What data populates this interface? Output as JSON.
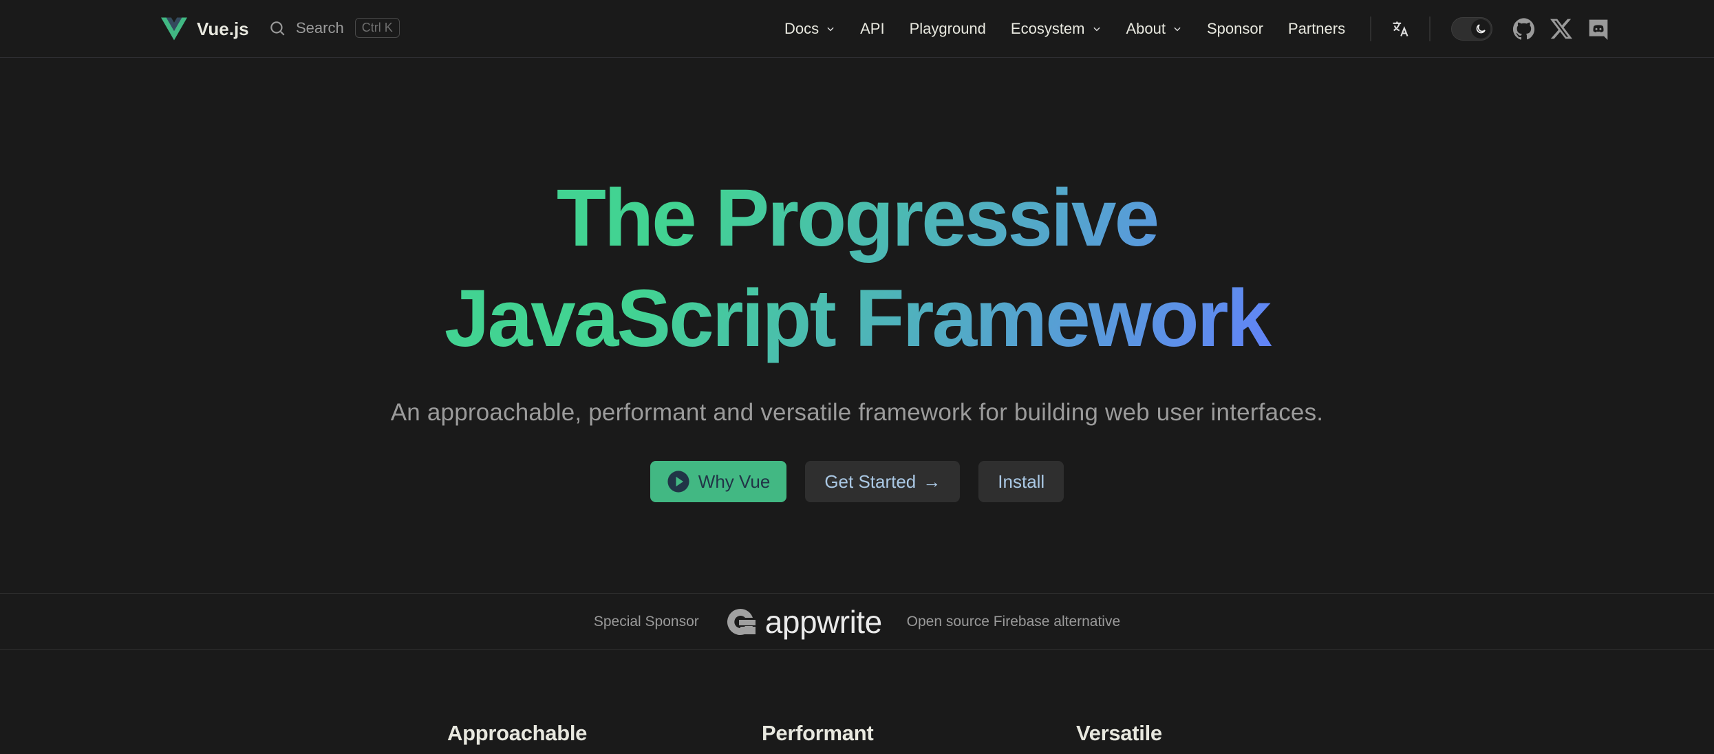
{
  "nav": {
    "logo_text": "Vue.js",
    "search_label": "Search",
    "search_shortcut": "Ctrl K",
    "links": [
      {
        "label": "Docs",
        "dropdown": true
      },
      {
        "label": "API",
        "dropdown": false
      },
      {
        "label": "Playground",
        "dropdown": false
      },
      {
        "label": "Ecosystem",
        "dropdown": true
      },
      {
        "label": "About",
        "dropdown": true
      },
      {
        "label": "Sponsor",
        "dropdown": false
      },
      {
        "label": "Partners",
        "dropdown": false
      }
    ],
    "icons": [
      "translate-icon",
      "dark-mode-toggle",
      "github-icon",
      "x-twitter-icon",
      "discord-icon"
    ]
  },
  "hero": {
    "title_line1": "The Progressive",
    "title_line2": "JavaScript Framework",
    "tagline": "An approachable, performant and versatile framework for building web user interfaces.",
    "buttons": {
      "why_vue": "Why Vue",
      "get_started": "Get Started",
      "get_started_arrow": "→",
      "install": "Install"
    }
  },
  "sponsor": {
    "label": "Special Sponsor",
    "name": "appwrite",
    "description": "Open source Firebase alternative"
  },
  "features": [
    {
      "title": "Approachable"
    },
    {
      "title": "Performant"
    },
    {
      "title": "Versatile"
    }
  ],
  "colors": {
    "brand": "#42b883",
    "gradient_start": "#42d392",
    "gradient_end": "#647eff",
    "background": "#1a1a1a"
  }
}
